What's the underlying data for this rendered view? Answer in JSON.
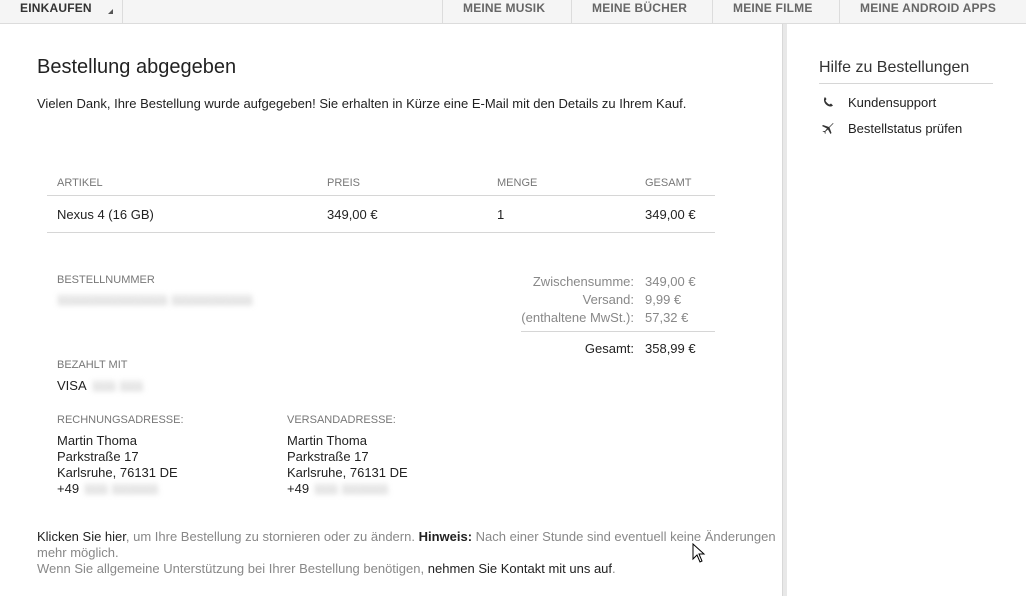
{
  "topnav": {
    "shop": "EINKAUFEN",
    "items": [
      "MEINE MUSIK",
      "MEINE BÜCHER",
      "MEINE FILME",
      "MEINE ANDROID APPS"
    ]
  },
  "main": {
    "title": "Bestellung abgegeben",
    "intro": "Vielen Dank, Ihre Bestellung wurde aufgegeben! Sie erhalten in Kürze eine E-Mail mit den Details zu Ihrem Kauf.",
    "table": {
      "headers": [
        "ARTIKEL",
        "PREIS",
        "MENGE",
        "GESAMT"
      ],
      "row": [
        "Nexus 4 (16 GB)",
        "349,00 €",
        "1",
        "349,00 €"
      ]
    },
    "order_number_label": "BESTELLNUMMER",
    "order_number": "1111111111111111111 11111111111111",
    "summary": {
      "subtotal_label": "Zwischensumme:",
      "subtotal": "349,00 €",
      "shipping_label": "Versand:",
      "shipping": "9,99 €",
      "vat_label": "(enthaltene MwSt.):",
      "vat": "57,32 €",
      "total_label": "Gesamt:",
      "total": "358,99 €"
    },
    "paid_with_label": "BEZAHLT MIT",
    "paid_with": "VISA",
    "paid_with_masked": "1111 1111",
    "billing": {
      "label": "RECHNUNGSADRESSE:",
      "name": "Martin Thoma",
      "street": "Parkstraße 17",
      "city": "Karlsruhe, 76131 DE",
      "phone_prefix": "+49",
      "phone_masked": "1111 11111111"
    },
    "shipping_address": {
      "label": "VERSANDADRESSE:",
      "name": "Martin Thoma",
      "street": "Parkstraße 17",
      "city": "Karlsruhe, 76131 DE",
      "phone_prefix": "+49",
      "phone_masked": "1111 11111111"
    },
    "footer": {
      "cancel_link": "Klicken Sie hier",
      "cancel_text": ", um Ihre Bestellung zu stornieren oder zu ändern.",
      "hint_label": "Hinweis:",
      "hint_text_1": "Nach einer Stunde sind eventuell keine Änderungen",
      "hint_text_2": "mehr möglich.",
      "support_text": "Wenn Sie allgemeine Unterstützung bei Ihrer Bestellung benötigen,",
      "contact_link": "nehmen Sie Kontakt mit uns auf",
      "period": "."
    }
  },
  "sidebar": {
    "title": "Hilfe zu Bestellungen",
    "items": [
      {
        "label": "Kundensupport",
        "icon": "phone-icon"
      },
      {
        "label": "Bestellstatus prüfen",
        "icon": "airplane-icon"
      }
    ]
  }
}
